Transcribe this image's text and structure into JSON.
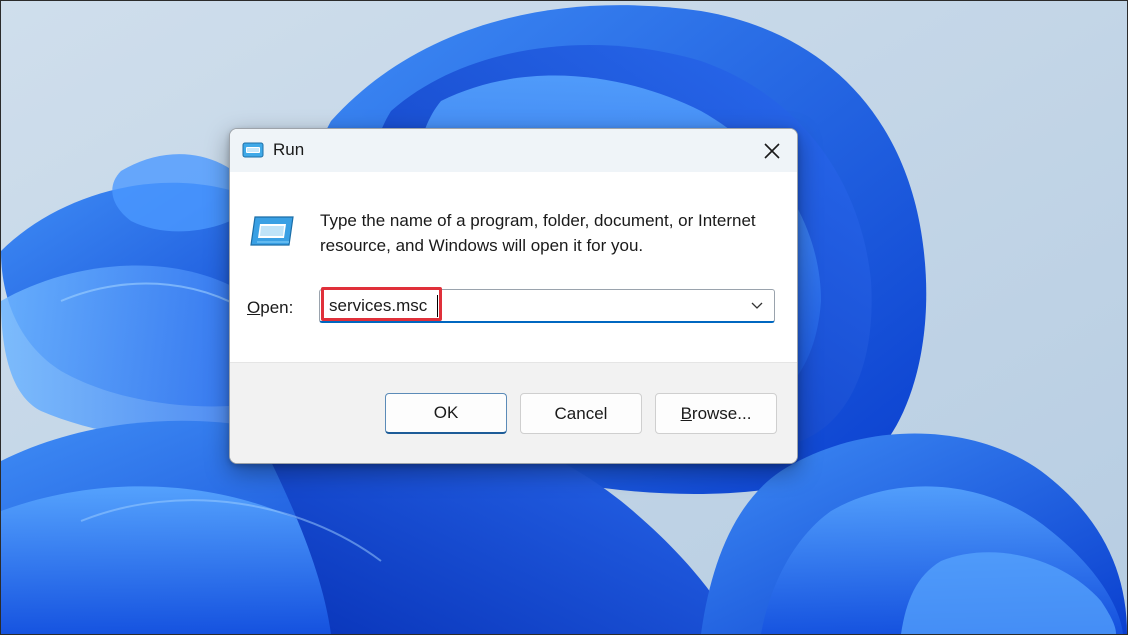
{
  "dialog": {
    "title": "Run",
    "description": "Type the name of a program, folder, document, or Internet resource, and Windows will open it for you.",
    "open_label_accel": "O",
    "open_label_rest": "pen:",
    "open_value": "services.msc",
    "buttons": {
      "ok": "OK",
      "cancel": "Cancel",
      "browse": "Browse..."
    }
  },
  "colors": {
    "highlight": "#e0303a",
    "accent": "#0067c0"
  },
  "icons": {
    "title": "run-icon",
    "body": "run-icon",
    "close": "close-icon",
    "dropdown": "chevron-down-icon"
  }
}
